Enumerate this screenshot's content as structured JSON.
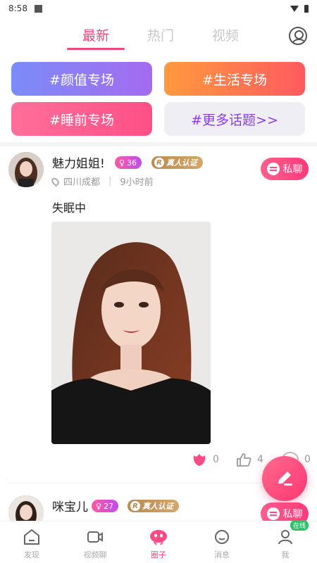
{
  "status_bar": {
    "time": "8:58"
  },
  "tabs": [
    {
      "label": "最新",
      "active": true
    },
    {
      "label": "热门",
      "active": false
    },
    {
      "label": "视频",
      "active": false
    }
  ],
  "topics": [
    {
      "label": "#颜值专场"
    },
    {
      "label": "#生活专场"
    },
    {
      "label": "#睡前专场"
    },
    {
      "label": "#更多话题>>"
    }
  ],
  "posts": [
    {
      "username": "魅力姐姐!",
      "level": "36",
      "verify_label": "真人认证",
      "verify_letter": "R",
      "location": "四川成都",
      "time_ago": "9小时前",
      "chat_label": "私聊",
      "text": "失眠中",
      "flowers": "0",
      "likes": "4",
      "comments": "0"
    },
    {
      "username": "咪宝儿",
      "level": "27",
      "verify_label": "真人认证",
      "verify_letter": "R",
      "chat_label": "私聊"
    }
  ],
  "bottom_nav": [
    {
      "label": "发现",
      "icon": "home-icon"
    },
    {
      "label": "视频聊",
      "icon": "video-icon"
    },
    {
      "label": "圈子",
      "icon": "circle-icon",
      "active": true
    },
    {
      "label": "消息",
      "icon": "message-icon"
    },
    {
      "label": "我",
      "icon": "person-icon",
      "badge": "在线"
    }
  ],
  "colors": {
    "accent": "#f2457b",
    "online": "#2ec26a",
    "verify_gold": "#b88b52"
  }
}
